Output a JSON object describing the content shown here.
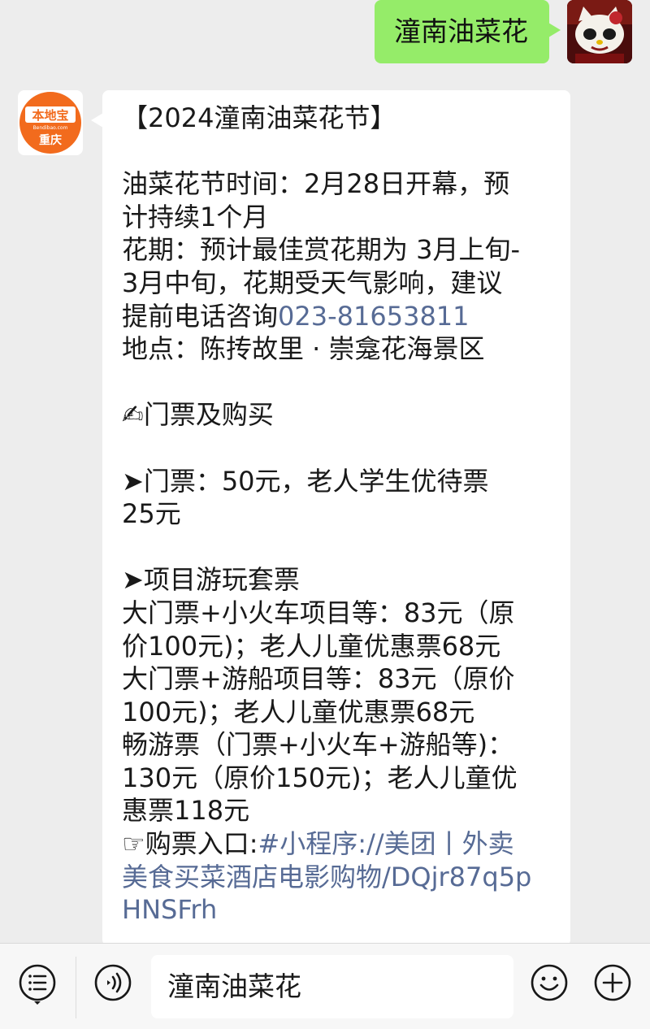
{
  "outgoing_message": {
    "text": "潼南油菜花"
  },
  "incoming_message": {
    "sender_avatar_text_top": "本地宝",
    "sender_avatar_text_mid": "Bendibao.com",
    "sender_avatar_text_bottom": "重庆",
    "title": "【2024潼南油菜花节】",
    "time_line_1": "油菜花节时间：2月28日开幕，预",
    "time_line_2": "计持续1个月",
    "period_line_1": "花期：预计最佳赏花期为 3月上旬-",
    "period_line_2": "3月中旬，花期受天气影响，建议",
    "period_line_3_prefix": "提前电话咨询",
    "phone": "023-81653811",
    "location": "地点：陈抟故里 · 崇龛花海景区",
    "ticket_heading": "✍门票及购买",
    "ticket_line_1": "➤门票：50元，老人学生优待票",
    "ticket_line_2": "25元",
    "package_heading": "➤项目游玩套票",
    "package_1_line_1": "大门票+小火车项目等：83元（原",
    "package_1_line_2": "价100元)；老人儿童优惠票68元",
    "package_2_line_1": "大门票+游船项目等：83元（原价",
    "package_2_line_2": "100元)；老人儿童优惠票68元",
    "package_3_line_1": "畅游票（门票+小火车+游船等)：",
    "package_3_line_2": "130元（原价150元)；老人儿童优",
    "package_3_line_3": "惠票118元",
    "purchase_prefix": "☞购票入口:",
    "purchase_link_1": "#小程序://美团丨外卖",
    "purchase_link_2": "美食买菜酒店电影购物/DQjr87q5p",
    "purchase_link_3": "HNSFrh"
  },
  "input_bar": {
    "input_text": "潼南油菜花"
  },
  "icons": {
    "menu": "list-menu-icon",
    "voice": "voice-icon",
    "emoji": "emoji-icon",
    "plus": "plus-icon"
  },
  "colors": {
    "outgoing_bubble": "#95ec69",
    "incoming_bubble": "#ffffff",
    "link": "#576b95",
    "background": "#ededed",
    "brand_orange": "#f26b1d"
  }
}
